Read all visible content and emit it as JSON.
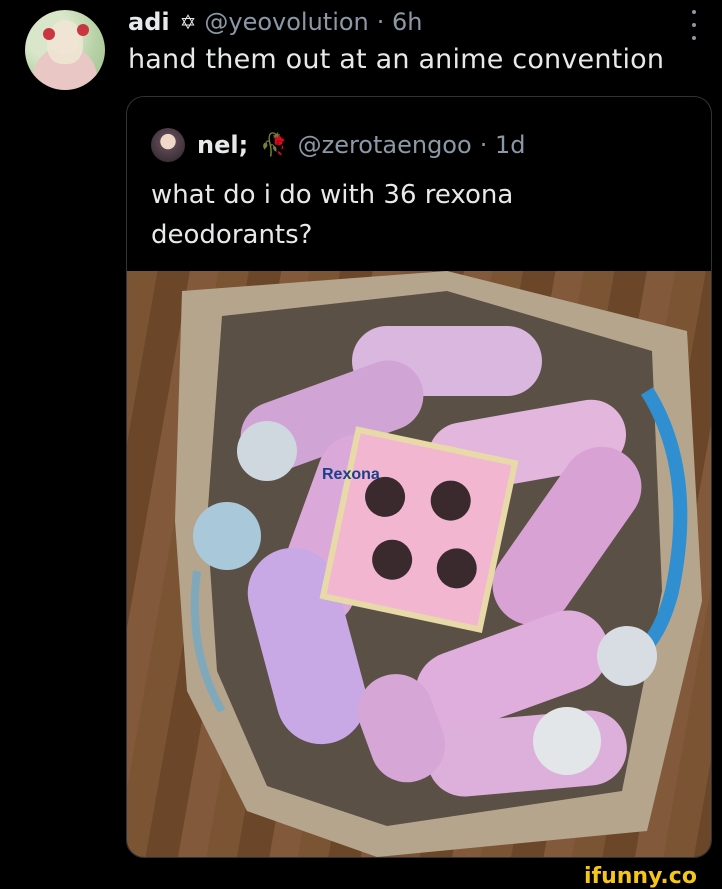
{
  "post": {
    "author_name": "adi",
    "author_badge": "✡",
    "handle": "@yeovolution",
    "time": "· 6h",
    "text": "hand them out at an anime convention"
  },
  "quoted": {
    "author_name": "nel;",
    "author_badge": "🥀",
    "handle": "@zerotaengoo",
    "time": "· 1d",
    "text": "what do i do with 36 rexona deodorants?"
  },
  "photo": {
    "brand_label": "Rexona"
  },
  "watermark": "ifunny.co"
}
